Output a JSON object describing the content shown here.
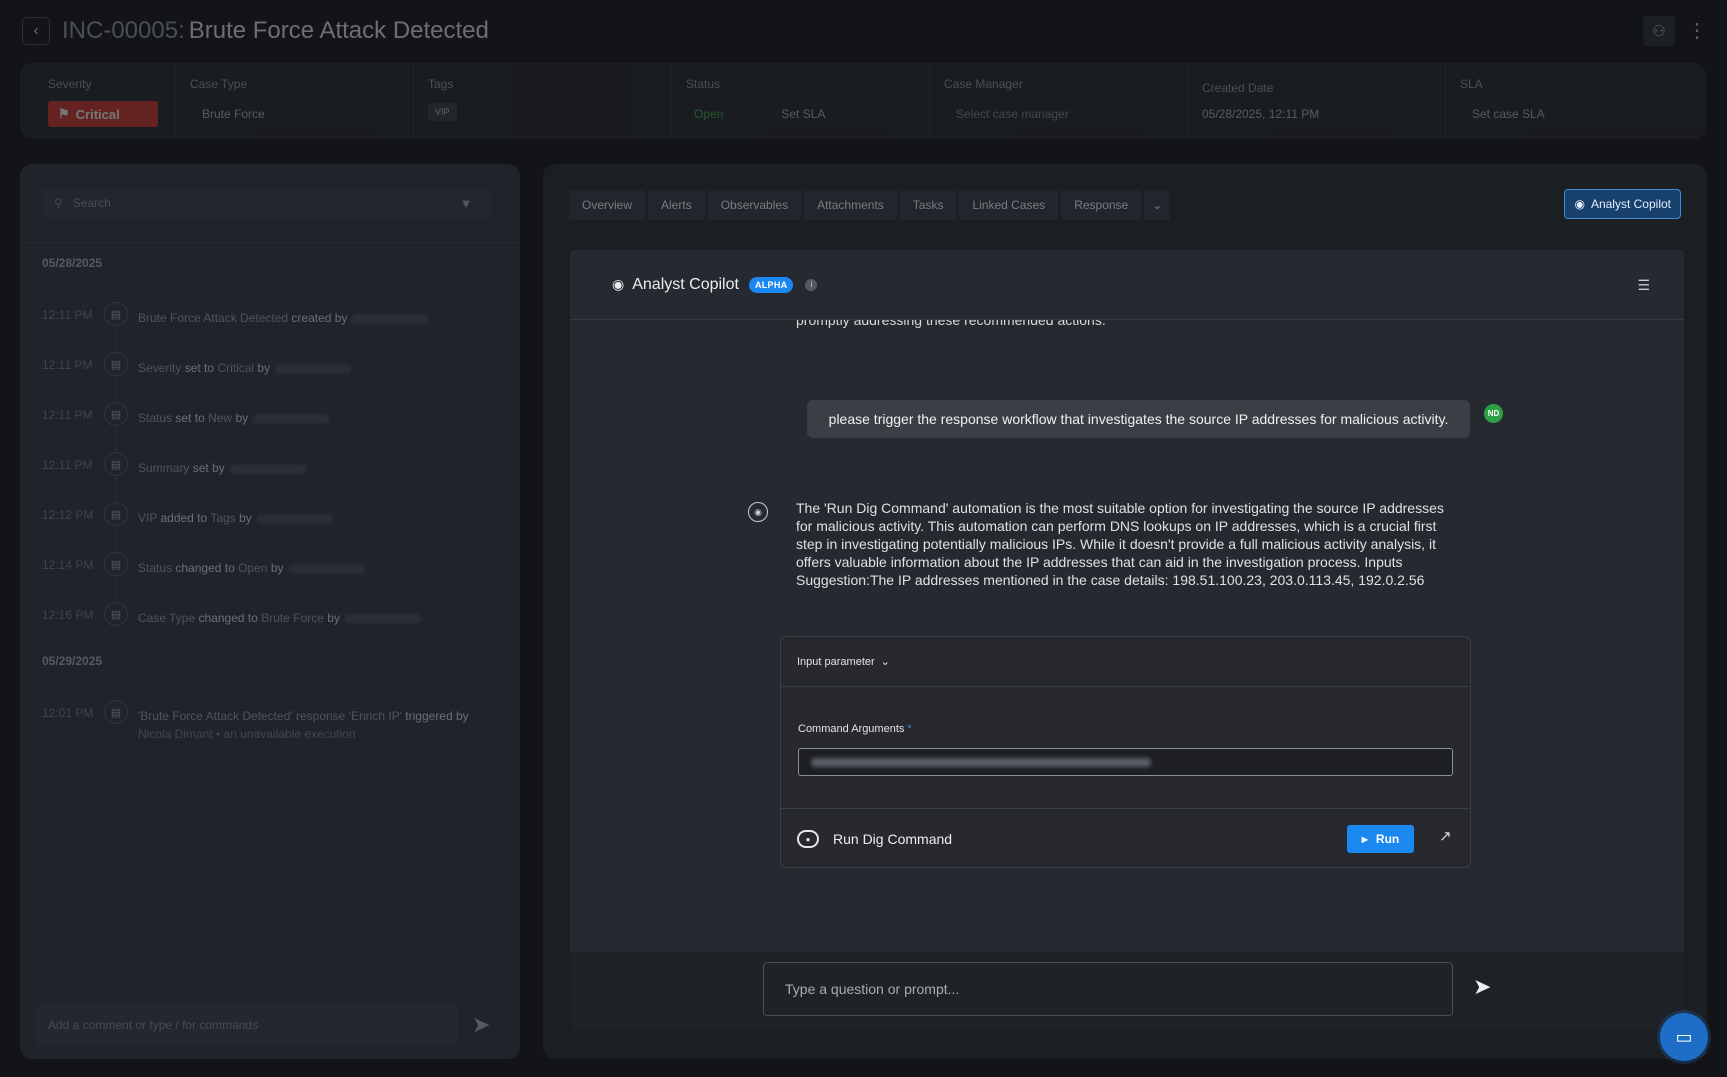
{
  "header": {
    "case_id": "INC-00005:",
    "case_title": "Brute Force Attack Detected"
  },
  "info": {
    "severity_label": "Severity",
    "severity_value": "Critical",
    "case_type_label": "Case Type",
    "case_type_value": "Brute Force",
    "tags_label": "Tags",
    "tag_value": "VIP",
    "status_label": "Status",
    "status_value": "Open",
    "set_sla": "Set SLA",
    "case_manager_label": "Case Manager",
    "case_manager_placeholder": "Select case manager",
    "created_date_label": "Created Date",
    "created_date_value": "05/28/2025, 12:11 PM",
    "sla_label": "SLA",
    "sla_value": "Set case SLA"
  },
  "timeline": {
    "search_placeholder": "Search",
    "dates": [
      "05/28/2025",
      "05/29/2025"
    ],
    "items": [
      {
        "time": "12:11 PM",
        "subject": "Brute Force Attack Detected",
        "action": "created by"
      },
      {
        "time": "12:11 PM",
        "subject": "Severity",
        "action": "set to",
        "value": "Critical",
        "tail": "by"
      },
      {
        "time": "12:11 PM",
        "subject": "Status",
        "action": "set to",
        "value": "New",
        "tail": "by"
      },
      {
        "time": "12:11 PM",
        "subject": "Summary",
        "action": "set by"
      },
      {
        "time": "12:12 PM",
        "subject": "VIP",
        "action": "added to",
        "value": "Tags",
        "tail": "by"
      },
      {
        "time": "12:14 PM",
        "subject": "Status",
        "action": "changed to",
        "value": "Open",
        "tail": "by"
      },
      {
        "time": "12:16 PM",
        "subject": "Case Type",
        "action": "changed to",
        "value": "Brute Force",
        "tail": "by"
      },
      {
        "time": "12:01 PM",
        "subject": "'Brute Force Attack Detected' response 'Enrich IP'",
        "action": "triggered by",
        "sub": "Nicola Dimant  •  an unavailable execution"
      }
    ],
    "comment_placeholder": "Add a comment or type / for commands"
  },
  "tabs": [
    "Overview",
    "Alerts",
    "Observables",
    "Attachments",
    "Tasks",
    "Linked Cases",
    "Response"
  ],
  "copilot_button": "Analyst Copilot",
  "copilot": {
    "title": "Analyst Copilot",
    "badge": "ALPHA",
    "info_glyph": "i",
    "cut_text": "promptly addressing these recommended actions.",
    "user_message": "please trigger the response workflow that investigates the source IP addresses for malicious activity.",
    "user_initials": "ND",
    "bot_message": "The 'Run Dig Command' automation is the most suitable option for investigating the source IP addresses for malicious activity. This automation can perform DNS lookups on IP addresses, which is a crucial first step in investigating potentially malicious IPs. While it doesn't provide a full malicious activity analysis, it offers valuable information about the IP addresses that can aid in the investigation process. Inputs Suggestion:The IP addresses mentioned in the case details: 198.51.100.23, 203.0.113.45, 192.0.2.56",
    "param_header": "Input parameter",
    "arg_label": "Command Arguments",
    "arg_required": "*",
    "automation_name": "Run Dig Command",
    "run_label": "Run",
    "prompt_placeholder": "Type a question or prompt..."
  },
  "icons": {
    "back": "chevron-left-icon",
    "assign": "assign-user-icon",
    "kebab": "kebab-icon",
    "flag": "flag-icon",
    "search": "search-icon",
    "filter": "filter-icon",
    "note": "note-icon",
    "send": "send-icon",
    "copilot": "copilot-icon",
    "settings": "settings-icon",
    "play": "play-icon",
    "external": "external-link-icon",
    "chat": "chat-icon"
  },
  "colors": {
    "severity": "#d6382c",
    "status_open": "#3fb950",
    "accent": "#1a88f0",
    "avatar": "#2ea043"
  }
}
